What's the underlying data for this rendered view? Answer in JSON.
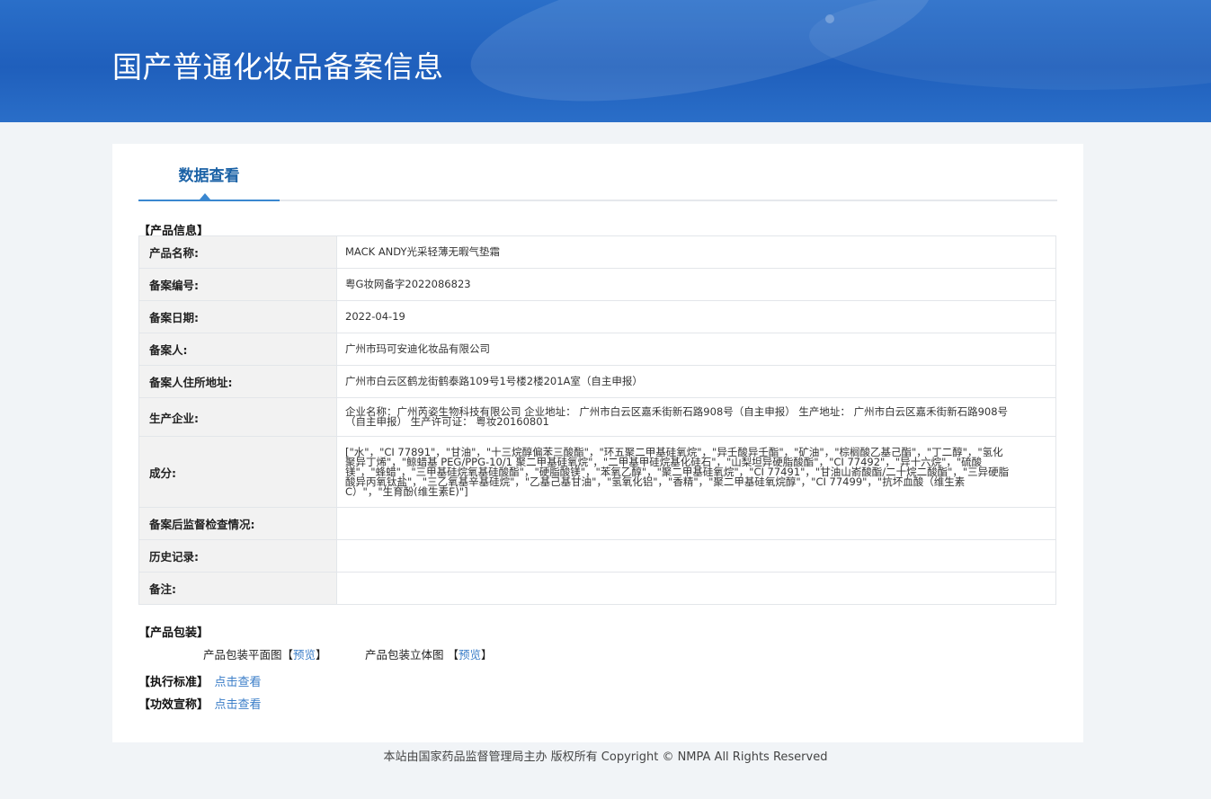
{
  "header": {
    "title": "国产普通化妆品备案信息"
  },
  "tabs": [
    {
      "label": "数据查看",
      "active": true
    }
  ],
  "product_info": {
    "section_title": "【产品信息】",
    "rows": [
      {
        "label": "产品名称:",
        "value": "MACK ANDY光采轻薄无暇气垫霜"
      },
      {
        "label": "备案编号:",
        "value": "粤G妆网备字2022086823"
      },
      {
        "label": "备案日期:",
        "value": "2022-04-19"
      },
      {
        "label": "备案人:",
        "value": "广州市玛可安迪化妆品有限公司"
      },
      {
        "label": "备案人住所地址:",
        "value": "广州市白云区鹤龙街鹤泰路109号1号楼2楼201A室（自主申报）"
      },
      {
        "label": "生产企业:",
        "value": "企业名称：广州芮姿生物科技有限公司 企业地址： 广州市白云区嘉禾街新石路908号（自主申报） 生产地址： 广州市白云区嘉禾街新石路908号（自主申报） 生产许可证： 粤妆20160801"
      },
      {
        "label": "成分:",
        "value": "[\"水\"，\"CI 77891\"，\"甘油\"，\"十三烷醇偏苯三酸酯\"，\"环五聚二甲基硅氧烷\"，\"异壬酸异壬酯\"，\"矿油\"，\"棕榈酸乙基己酯\"，\"丁二醇\"，\"氢化聚异丁烯\"，\"鲸蜡基 PEG/PPG-10/1 聚二甲基硅氧烷\"，\"二甲基甲硅烷基化硅石\"，\"山梨坦异硬脂酸酯\"，\"CI 77492\"，\"异十六烷\"，\"硫酸镁\"，\"蜂蜡\"，\"三甲基硅烷氧基硅酸酯\"，\"硬脂酸镁\"，\"苯氧乙醇\"，\"聚二甲基硅氧烷\"，\"CI 77491\"，\"甘油山嵛酸酯/二十烷二酸酯\"，\"三异硬脂酸异丙氧钛盐\"，\"三乙氧基辛基硅烷\"，\"乙基己基甘油\"，\"氢氧化铝\"，\"香精\"，\"聚二甲基硅氧烷醇\"，\"CI 77499\"，\"抗坏血酸（维生素C）\"，\"生育酚(维生素E)\"]"
      },
      {
        "label": "备案后监督检查情况:",
        "value": ""
      },
      {
        "label": "历史记录:",
        "value": ""
      },
      {
        "label": "备注:",
        "value": ""
      }
    ]
  },
  "packaging": {
    "section_title": "【产品包装】",
    "flat_label": "产品包装平面图",
    "solid_label": "产品包装立体图",
    "bracket_open": "【",
    "bracket_close": "】",
    "preview_label": "预览"
  },
  "standard": {
    "section_title": "【执行标准】",
    "link_label": "点击查看"
  },
  "efficacy": {
    "section_title": "【功效宣称】",
    "link_label": "点击查看"
  },
  "footer": {
    "text": "本站由国家药品监督管理局主办 版权所有 Copyright © NMPA All Rights Reserved"
  },
  "colors": {
    "banner": "#1f5fbc",
    "tab_text": "#1b62a6",
    "link": "#3b7ec8",
    "table_border": "#9ec2e4",
    "label_bg": "#f2f2f2"
  }
}
